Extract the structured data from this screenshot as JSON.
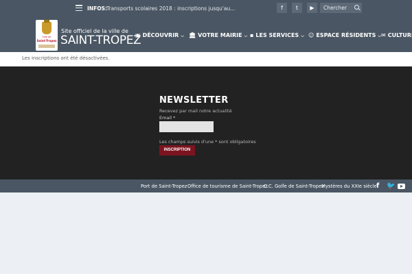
{
  "topbar": {
    "infos_label": "INFOS:",
    "infos_text": "Transports scolaires 2018 : inscriptions jusqu'au...",
    "search_placeholder": "Chercher",
    "social": [
      "facebook-icon",
      "twitter-icon",
      "youtube-icon"
    ]
  },
  "logo": {
    "ville_de": "Ville de",
    "name": "Saint-Tropez"
  },
  "site": {
    "subtitle": "Site officiel de la ville de",
    "title": "SAINT-TROPEZ"
  },
  "nav": {
    "items": [
      {
        "label": "DÉCOUVRIR",
        "icon": "image-icon"
      },
      {
        "label": "VOTRE MAIRIE",
        "icon": "building-icon"
      },
      {
        "label": "LES SERVICES",
        "icon": "services-icon"
      },
      {
        "label": "ESPACE RÉSIDENTS",
        "icon": "user-icon"
      },
      {
        "label": "CULTURE",
        "icon": "chat-icon"
      }
    ]
  },
  "notice": {
    "text": "Les inscriptions ont été désactivées."
  },
  "newsletter": {
    "title": "NEWSLETTER",
    "description": "Recevez par mail notre actualité",
    "email_label": "Email *",
    "email_value": "",
    "required_note": "Les champs suivis d'une * sont obligatoires",
    "button_label": "INSCRIPTION"
  },
  "footer": {
    "links": [
      "Port de Saint-Tropez",
      "Office de tourisme de Saint-Tropez",
      "C.C. Golfe de Saint-Tropez",
      "Mystères du XXIe siècle"
    ],
    "social": [
      "facebook-icon",
      "twitter-icon",
      "youtube-icon"
    ]
  },
  "colors": {
    "header_bg": "#4a5663",
    "newsletter_bg": "#222222",
    "button_bg": "#7b1420",
    "page_bg": "#eceff3"
  }
}
